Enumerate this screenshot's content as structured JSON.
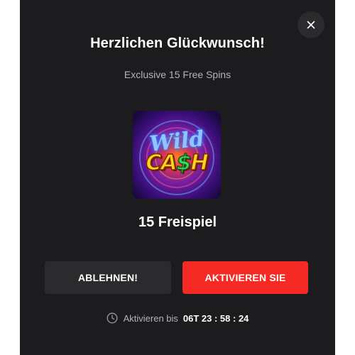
{
  "modal": {
    "title": "Herzlichen Glückwunsch!",
    "subtitle": "Exclusive 15 Free Spins",
    "close_icon": "close-icon",
    "game": {
      "logo_line1": "Wild",
      "logo_cash_prefix": "CA",
      "logo_cash_dollar": "$",
      "logo_cash_suffix": "H"
    },
    "reward_text": "15 Freispiel",
    "buttons": {
      "decline_label": "ABLEHNEN!",
      "activate_label": "AKTIVIEREN SIE"
    },
    "timer": {
      "icon": "clock-icon",
      "label": "Aktivieren bis",
      "value": "06T 23 : 58 : 24"
    }
  },
  "colors": {
    "modal_background": "#1c1c1e",
    "secondary_button": "#2b2b2e",
    "accent_red": "#f52a24",
    "muted_text": "#b4b4b8"
  }
}
